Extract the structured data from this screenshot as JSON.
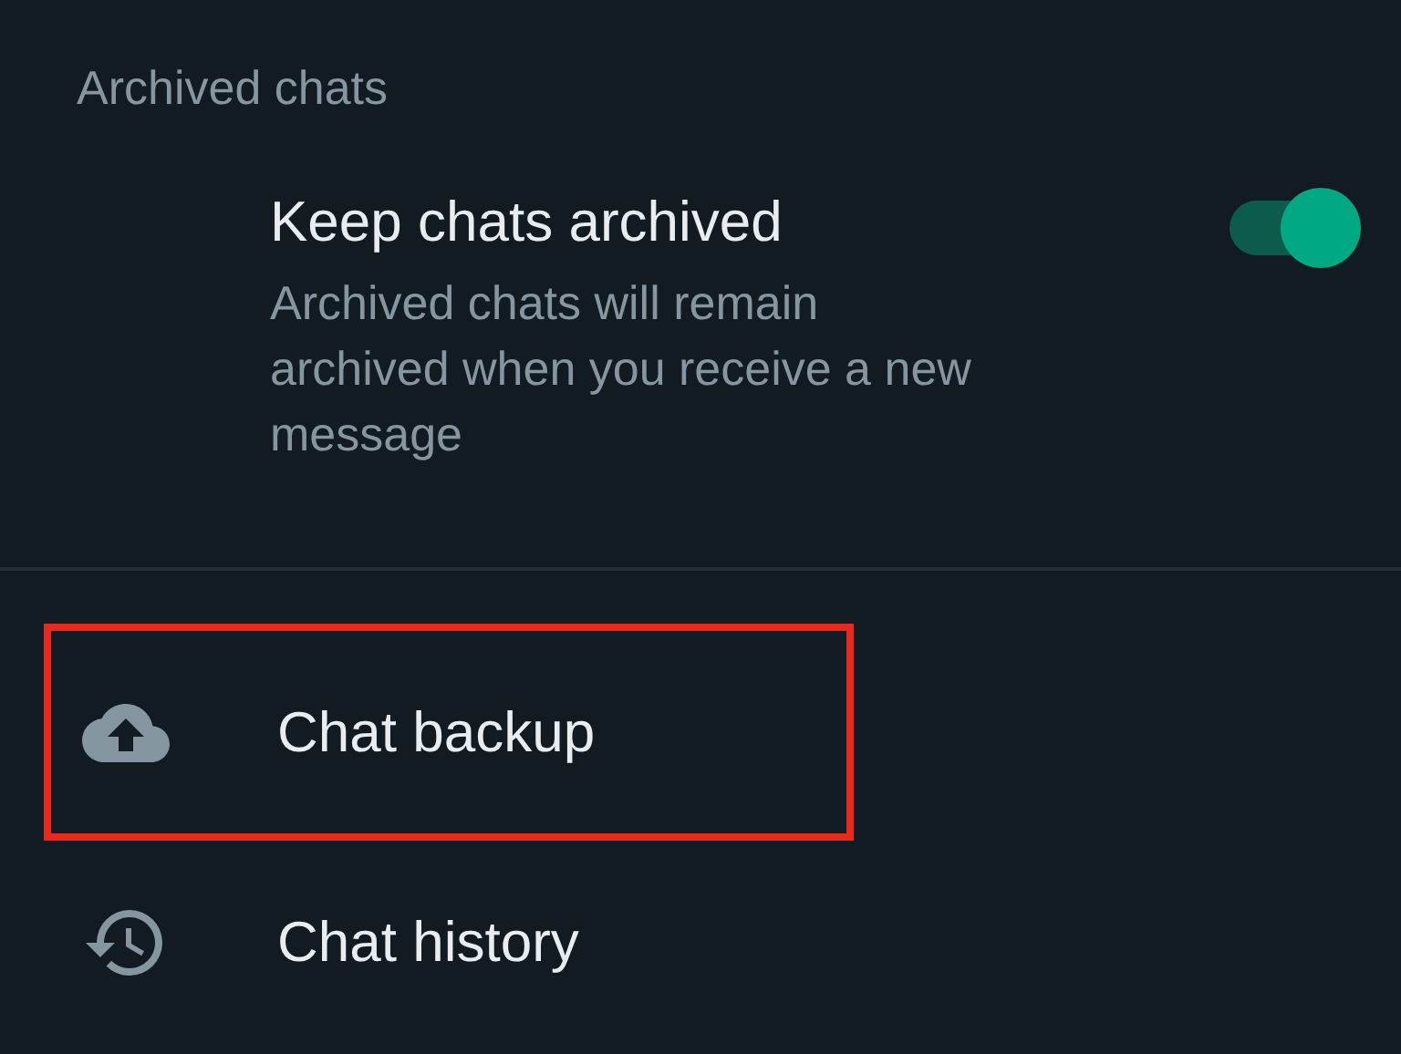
{
  "section_title": "Archived chats",
  "setting": {
    "title": "Keep chats archived",
    "description": "Archived chats will remain archived when you receive a new message",
    "on": true
  },
  "items": [
    {
      "kind": "backup",
      "label": "Chat backup",
      "highlighted": true
    },
    {
      "kind": "history",
      "label": "Chat history",
      "highlighted": false
    }
  ]
}
